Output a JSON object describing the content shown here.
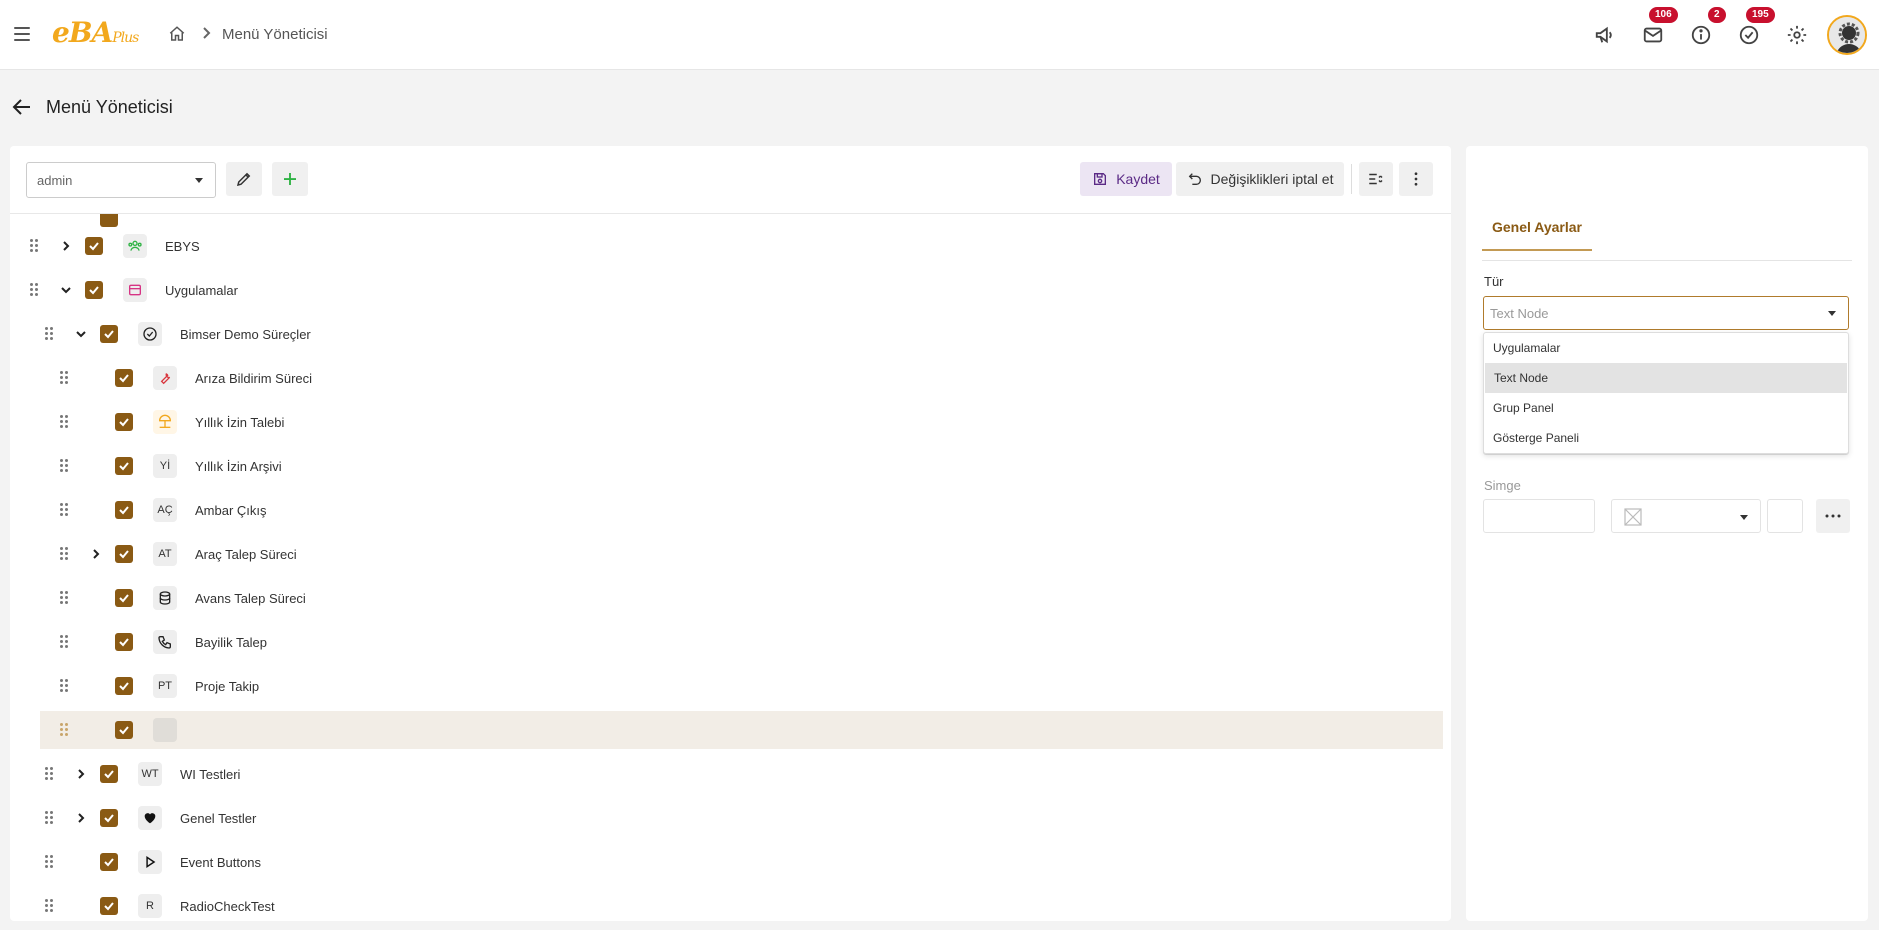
{
  "app": {
    "logo": "eBA",
    "logo_suffix": "Plus"
  },
  "breadcrumb": {
    "current": "Menü Yöneticisi"
  },
  "notifications": {
    "mail_count": "106",
    "info_count": "2",
    "tasks_count": "195"
  },
  "page": {
    "title": "Menü Yöneticisi"
  },
  "toolbar": {
    "user_select_value": "admin",
    "save_label": "Kaydet",
    "cancel_label": "Değişiklikleri iptal et"
  },
  "tree": {
    "items": [
      {
        "label": "EBYS",
        "icon": "people-group-icon",
        "icon_color": "#2fb344"
      },
      {
        "label": "Uygulamalar",
        "icon": "store-icon",
        "icon_color": "#d63384"
      },
      {
        "label": "Bimser Demo Süreçler",
        "icon": "check-circle-icon"
      },
      {
        "label": "Arıza Bildirim Süreci",
        "icon": "wrench-icon",
        "icon_color": "#d9363e"
      },
      {
        "label": "Yıllık İzin Talebi",
        "icon": "beach-icon",
        "icon_color": "#f2a81d"
      },
      {
        "label": "Yıllık İzin Arşivi",
        "abbr": "Yİ"
      },
      {
        "label": "Ambar Çıkış",
        "abbr": "AÇ"
      },
      {
        "label": "Araç Talep Süreci",
        "abbr": "AT"
      },
      {
        "label": "Avans Talep Süreci",
        "icon": "database-icon"
      },
      {
        "label": "Bayilik Talep",
        "icon": "phone-icon"
      },
      {
        "label": "Proje Takip",
        "abbr": "PT"
      },
      {
        "label": "",
        "abbr": ""
      },
      {
        "label": "WI Testleri",
        "abbr": "WT"
      },
      {
        "label": "Genel Testler",
        "icon": "heart-icon"
      },
      {
        "label": "Event Buttons",
        "icon": "play-icon"
      },
      {
        "label": "RadioCheckTest",
        "abbr": "R"
      }
    ]
  },
  "settings": {
    "tab_label": "Genel Ayarlar",
    "type_label": "Tür",
    "type_placeholder": "Text Node",
    "type_options": [
      "Uygulamalar",
      "Text Node",
      "Grup Panel",
      "Gösterge Paneli"
    ],
    "type_selected": "Text Node",
    "icon_label": "Simge"
  },
  "colors": {
    "accent": "#8a5a14",
    "badge": "#c8102e",
    "logo": "#f2a81d",
    "highlight_row": "#f2ede6"
  }
}
